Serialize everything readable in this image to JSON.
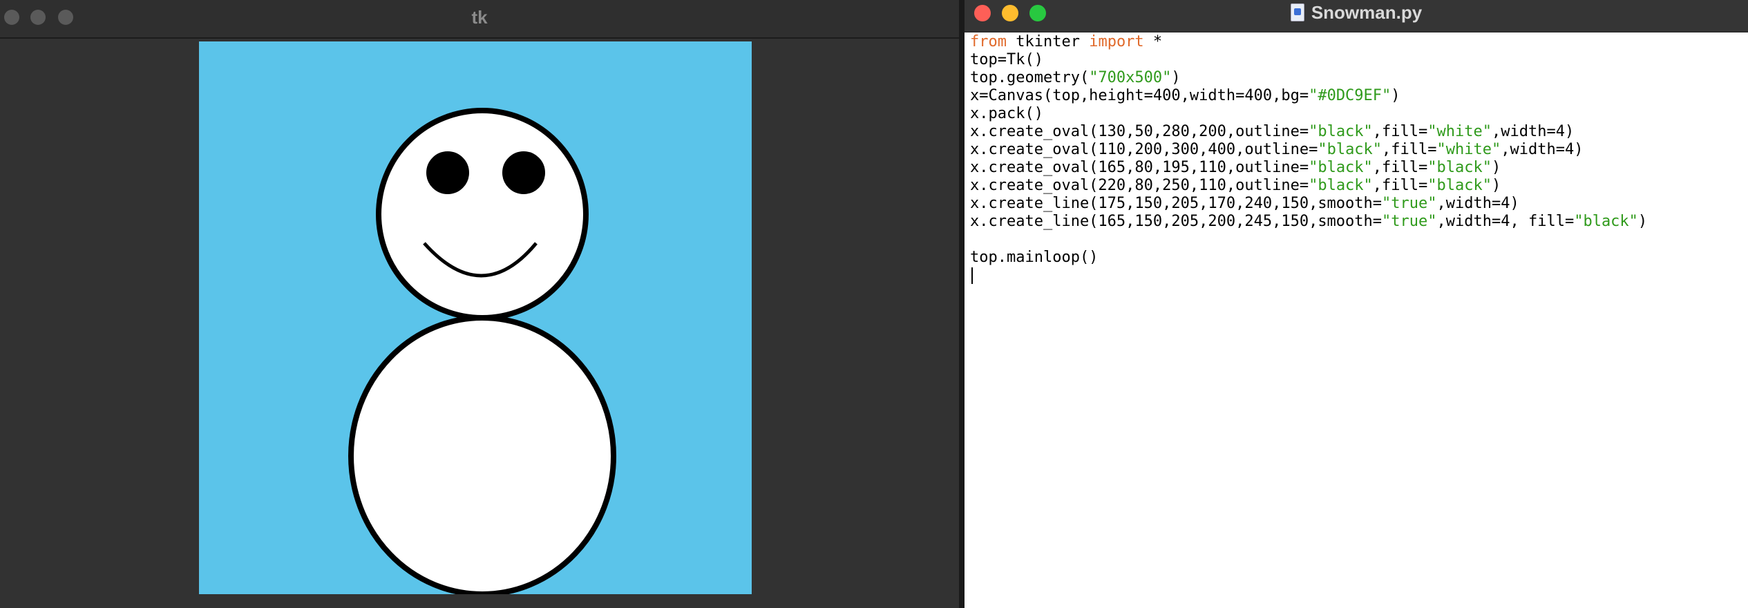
{
  "tk_window": {
    "title": "tk",
    "canvas_bg": "#0DC9EF",
    "canvas_bg_display": "#5BC4EA"
  },
  "editor": {
    "title": "Snowman.py",
    "code_lines": [
      [
        {
          "t": "from",
          "c": "kw"
        },
        {
          "t": " tkinter ",
          "c": ""
        },
        {
          "t": "import",
          "c": "kw"
        },
        {
          "t": " *",
          "c": ""
        }
      ],
      [
        {
          "t": "top=Tk()",
          "c": ""
        }
      ],
      [
        {
          "t": "top.geometry(",
          "c": ""
        },
        {
          "t": "\"700x500\"",
          "c": "str"
        },
        {
          "t": ")",
          "c": ""
        }
      ],
      [
        {
          "t": "x=Canvas(top,height=400,width=400,bg=",
          "c": ""
        },
        {
          "t": "\"#0DC9EF\"",
          "c": "str"
        },
        {
          "t": ")",
          "c": ""
        }
      ],
      [
        {
          "t": "x.pack()",
          "c": ""
        }
      ],
      [
        {
          "t": "x.create_oval(130,50,280,200,outline=",
          "c": ""
        },
        {
          "t": "\"black\"",
          "c": "str"
        },
        {
          "t": ",fill=",
          "c": ""
        },
        {
          "t": "\"white\"",
          "c": "str"
        },
        {
          "t": ",width=4)",
          "c": ""
        }
      ],
      [
        {
          "t": "x.create_oval(110,200,300,400,outline=",
          "c": ""
        },
        {
          "t": "\"black\"",
          "c": "str"
        },
        {
          "t": ",fill=",
          "c": ""
        },
        {
          "t": "\"white\"",
          "c": "str"
        },
        {
          "t": ",width=4)",
          "c": ""
        }
      ],
      [
        {
          "t": "x.create_oval(165,80,195,110,outline=",
          "c": ""
        },
        {
          "t": "\"black\"",
          "c": "str"
        },
        {
          "t": ",fill=",
          "c": ""
        },
        {
          "t": "\"black\"",
          "c": "str"
        },
        {
          "t": ")",
          "c": ""
        }
      ],
      [
        {
          "t": "x.create_oval(220,80,250,110,outline=",
          "c": ""
        },
        {
          "t": "\"black\"",
          "c": "str"
        },
        {
          "t": ",fill=",
          "c": ""
        },
        {
          "t": "\"black\"",
          "c": "str"
        },
        {
          "t": ")",
          "c": ""
        }
      ],
      [
        {
          "t": "x.create_line(175,150,205,170,240,150,smooth=",
          "c": ""
        },
        {
          "t": "\"true\"",
          "c": "str"
        },
        {
          "t": ",width=4)",
          "c": ""
        }
      ],
      [
        {
          "t": "x.create_line(165,150,205,200,245,150,smooth=",
          "c": ""
        },
        {
          "t": "\"true\"",
          "c": "str"
        },
        {
          "t": ",width=4, fill=",
          "c": ""
        },
        {
          "t": "\"black\"",
          "c": "str"
        },
        {
          "t": ")",
          "c": ""
        }
      ],
      [
        {
          "t": "",
          "c": ""
        }
      ],
      [
        {
          "t": "top.mainloop()",
          "c": ""
        }
      ]
    ]
  },
  "colors": {
    "keyword": "#e0692a",
    "string": "#2f9a1b",
    "close": "#fe5f57",
    "minimize": "#febc2e",
    "maximize": "#28c840"
  }
}
